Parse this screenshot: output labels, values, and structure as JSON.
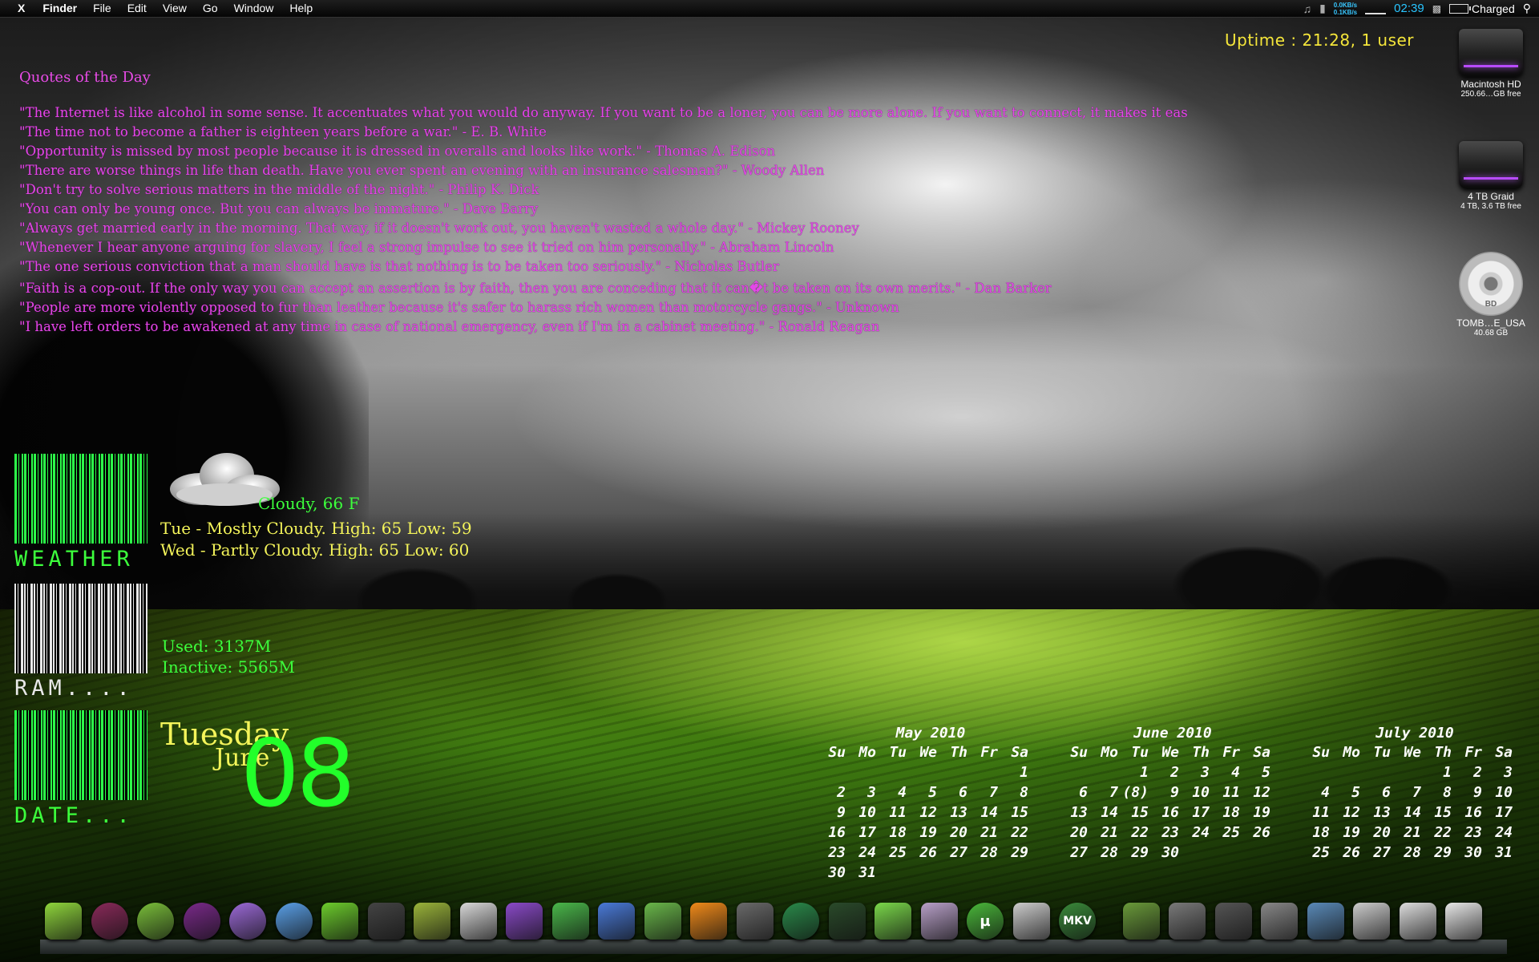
{
  "menubar": {
    "apple": "X",
    "app": "Finder",
    "items": [
      "File",
      "Edit",
      "View",
      "Go",
      "Window",
      "Help"
    ],
    "net_up": "0.0KB/s",
    "net_down": "0.1KB/s",
    "clock": "02:39",
    "battery": "Charged"
  },
  "uptime": "Uptime : 21:28, 1 user",
  "quotes": {
    "title": "Quotes of the Day",
    "items": [
      "\"The Internet is like alcohol in some sense. It accentuates what you would do anyway. If you want to be a loner, you can be more alone. If you want to connect, it makes it eas",
      "\"The time not to become a father is eighteen years before a war.\" - E. B. White",
      "\"Opportunity is missed by most people because it is dressed in overalls and looks like work.\" - Thomas A. Edison",
      "\"There are worse things in life than death. Have you ever spent an evening with an insurance salesman?\" - Woody Allen",
      "\"Don't try to solve serious matters in the middle of the night.\" - Philip K. Dick",
      "\"You can only be young once. But you can always be immature.\" - Dave Barry",
      "\"Always get married early in the morning. That way, if it doesn't work out, you haven't wasted a whole day.\" - Mickey Rooney",
      "\"Whenever I hear anyone arguing for slavery, I feel a strong impulse to see it tried on him personally.\" - Abraham Lincoln",
      "\"The one serious conviction that a man should have is that nothing is to be taken too seriously.\" - Nicholas Butler",
      "\"Faith is a cop-out. If the only way you can accept an assertion is by faith, then you are conceding that it can�t be taken on its own merits.\" - Dan Barker",
      "\"People are more violently opposed to fur than leather because it's safer to harass rich women than motorcycle gangs.\" - Unknown",
      "\"I have left orders to be awakened at any time in case of national emergency, even if I'm in a cabinet meeting.\" - Ronald Reagan"
    ]
  },
  "weather": {
    "label": "WEATHER",
    "current": "Cloudy, 66 F",
    "forecast": [
      "Tue - Mostly Cloudy. High: 65 Low: 59",
      "Wed - Partly Cloudy. High: 65 Low: 60"
    ]
  },
  "ram": {
    "label": "RAM....",
    "used": "Used: 3137M",
    "inactive": "Inactive:  5565M"
  },
  "date": {
    "label": "DATE...",
    "weekday": "Tuesday",
    "month": "June",
    "day": "08"
  },
  "calendars": [
    {
      "title": "May 2010",
      "headers": [
        "Su",
        "Mo",
        "Tu",
        "We",
        "Th",
        "Fr",
        "Sa"
      ],
      "weeks": [
        [
          "",
          "",
          "",
          "",
          "",
          "",
          "1"
        ],
        [
          "2",
          "3",
          "4",
          "5",
          "6",
          "7",
          "8"
        ],
        [
          "9",
          "10",
          "11",
          "12",
          "13",
          "14",
          "15"
        ],
        [
          "16",
          "17",
          "18",
          "19",
          "20",
          "21",
          "22"
        ],
        [
          "23",
          "24",
          "25",
          "26",
          "27",
          "28",
          "29"
        ],
        [
          "30",
          "31",
          "",
          "",
          "",
          "",
          ""
        ]
      ]
    },
    {
      "title": "June 2010",
      "headers": [
        "Su",
        "Mo",
        "Tu",
        "We",
        "Th",
        "Fr",
        "Sa"
      ],
      "weeks": [
        [
          "",
          "",
          "1",
          "2",
          "3",
          "4",
          "5"
        ],
        [
          "6",
          "7",
          "(8)",
          "9",
          "10",
          "11",
          "12"
        ],
        [
          "13",
          "14",
          "15",
          "16",
          "17",
          "18",
          "19"
        ],
        [
          "20",
          "21",
          "22",
          "23",
          "24",
          "25",
          "26"
        ],
        [
          "27",
          "28",
          "29",
          "30",
          "",
          "",
          ""
        ]
      ]
    },
    {
      "title": "July 2010",
      "headers": [
        "Su",
        "Mo",
        "Tu",
        "We",
        "Th",
        "Fr",
        "Sa"
      ],
      "weeks": [
        [
          "",
          "",
          "",
          "",
          "1",
          "2",
          "3"
        ],
        [
          "4",
          "5",
          "6",
          "7",
          "8",
          "9",
          "10"
        ],
        [
          "11",
          "12",
          "13",
          "14",
          "15",
          "16",
          "17"
        ],
        [
          "18",
          "19",
          "20",
          "21",
          "22",
          "23",
          "24"
        ],
        [
          "25",
          "26",
          "27",
          "28",
          "29",
          "30",
          "31"
        ]
      ]
    }
  ],
  "drives": [
    {
      "name": "Macintosh HD",
      "sub": "250.66…GB free",
      "icon": "hard-drive-icon"
    },
    {
      "name": "4 TB Graid",
      "sub": "4 TB, 3.6 TB free",
      "icon": "hard-drive-icon"
    },
    {
      "name": "TOMB…E_USA",
      "sub": "40.68 GB",
      "icon": "bluray-disc-icon",
      "disc_label": "BD"
    }
  ],
  "dock": {
    "utorrent_glyph": "µ",
    "mkv_label": "MKV",
    "items": [
      {
        "name": "app-icon-1",
        "color": "#8fd63c"
      },
      {
        "name": "app-icon-2",
        "color": "#8a2a5a"
      },
      {
        "name": "chrome-icon",
        "color": "#7abf3a"
      },
      {
        "name": "firefox-icon",
        "color": "#7a2a8a"
      },
      {
        "name": "safari-icon",
        "color": "#9c6ad8"
      },
      {
        "name": "itunes-icon",
        "color": "#5aa0e8"
      },
      {
        "name": "adium-icon",
        "color": "#6ccc2c"
      },
      {
        "name": "headphones-icon",
        "color": "#444444"
      },
      {
        "name": "preview-icon",
        "color": "#9ab43a"
      },
      {
        "name": "textedit-icon",
        "color": "#d8d8d8"
      },
      {
        "name": "stamp-icon",
        "color": "#8a4ac8"
      },
      {
        "name": "address-book-icon",
        "color": "#4ab84a"
      },
      {
        "name": "bird-icon",
        "color": "#4a7ad8"
      },
      {
        "name": "paper-icon",
        "color": "#6ab84a"
      },
      {
        "name": "vlc-icon",
        "color": "#f08a1a"
      },
      {
        "name": "dvd-icon",
        "color": "#6a6a6a"
      },
      {
        "name": "time-machine-icon",
        "color": "#2a8a4a"
      },
      {
        "name": "terminal-icon",
        "color": "#2a4a2a"
      },
      {
        "name": "notes-icon",
        "color": "#7ad84a"
      },
      {
        "name": "system-prefs-icon",
        "color": "#b8a0c8"
      },
      {
        "name": "utorrent-icon",
        "color": "#4ab83a"
      },
      {
        "name": "document-icon",
        "color": "#cccccc"
      },
      {
        "name": "mkv-icon",
        "color": "#3a8a3a"
      },
      {
        "name": "folder-icon-1",
        "color": "#6a9a3a"
      },
      {
        "name": "folder-icon-2",
        "color": "#7a7a7a"
      },
      {
        "name": "folder-icon-3",
        "color": "#555555"
      },
      {
        "name": "folder-icon-4",
        "color": "#888888"
      },
      {
        "name": "photos-icon",
        "color": "#5a8ab8"
      },
      {
        "name": "document-stack-icon",
        "color": "#cccccc"
      },
      {
        "name": "screenshot-icon",
        "color": "#dddddd"
      },
      {
        "name": "trash-icon",
        "color": "#e8e8e8"
      }
    ]
  }
}
